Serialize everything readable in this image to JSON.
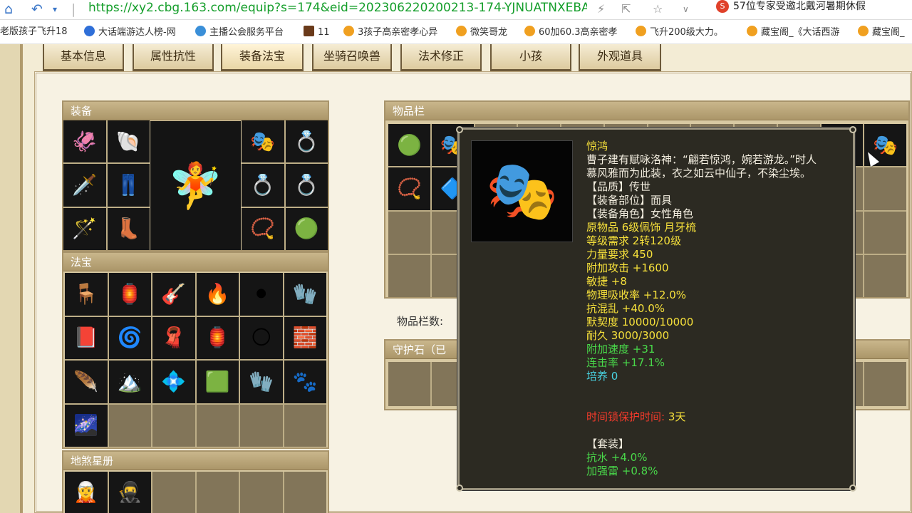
{
  "browser": {
    "url": "https://xy2.cbg.163.com/equip?s=174&eid=202306220200213-174-YJNUATNXEBAA&o&",
    "promo": "57位专家受邀北戴河暑期休假"
  },
  "bookmarks": [
    {
      "label": "老版孩子飞升18",
      "color": "#f0a020"
    },
    {
      "label": "大话端游达人榜-网",
      "color": "#2f6fd8"
    },
    {
      "label": "主播公会服务平台",
      "color": "#3a8fd8"
    },
    {
      "label": "11",
      "color": "#6a3a1a"
    },
    {
      "label": "3孩子高亲密孝心异",
      "color": "#f0a020"
    },
    {
      "label": "微笑哥龙",
      "color": "#f0a020"
    },
    {
      "label": "60加60.3高亲密孝",
      "color": "#f0a020"
    },
    {
      "label": "飞升200级大力。",
      "color": "#f0a020"
    },
    {
      "label": "藏宝阁_《大话西游",
      "color": "#f0a020"
    },
    {
      "label": "藏宝阁_",
      "color": "#f0a020"
    }
  ],
  "tabs": [
    "基本信息",
    "属性抗性",
    "装备法宝",
    "坐骑召唤兽",
    "法术修正",
    "小孩",
    "外观道具"
  ],
  "sections": {
    "equip": "装备",
    "treasure": "法宝",
    "star": "地煞星册",
    "inventory": "物品栏",
    "guardian": "守护石（已",
    "inventory_count_label": "物品栏数:"
  },
  "equip_icons": [
    "🦑",
    "🐚",
    "🗡️",
    "👖",
    "🪄",
    "👢"
  ],
  "equip_right_icons": [
    "🎭",
    "💍",
    "💍",
    "💍",
    "📿",
    "🟢"
  ],
  "treasure_icons": [
    "🪑",
    "🏮",
    "🎸",
    "🔥",
    "⚫",
    "🧤",
    "📕",
    "🌀",
    "🧣",
    "🏮",
    "🌕",
    "🧱",
    "🪶",
    "🏔️",
    "💠",
    "🟩",
    "🧤",
    "🐾",
    "🌌"
  ],
  "star_icons": [
    "🧝",
    "🥷"
  ],
  "inventory_icons": [
    "🟢",
    "🎭",
    "📿",
    "🔷"
  ],
  "tooltip": {
    "icon": "🎭",
    "name": "惊鸿",
    "desc1": "曹子建有赋咏洛神：“翩若惊鸿，婉若游龙。”时人",
    "desc2": "慕风雅而为此装，衣之如云中仙子，不染尘埃。",
    "quality": "【品质】传世",
    "slot": "【装备部位】面具",
    "role": "【装备角色】女性角色",
    "origin": "原物品 6级佩饰 月牙梳",
    "level": "等级需求 2转120级",
    "strength": "力量要求 450",
    "attack": "附加攻击 +1600",
    "agility": "敏捷 +8",
    "phys": "物理吸收率 +12.0%",
    "chaos": "抗混乱 +40.0%",
    "tacit": "默契度 10000/10000",
    "durability": "耐久 3000/3000",
    "speed": "附加速度 +31",
    "combo": "连击率 +17.1%",
    "cultivate": "培养 0",
    "lock_label": "时间锁保护时间:",
    "lock_value": "3天",
    "set_title": "【套装】",
    "set1": "抗水 +4.0%",
    "set2": "加强雷 +0.8%"
  }
}
